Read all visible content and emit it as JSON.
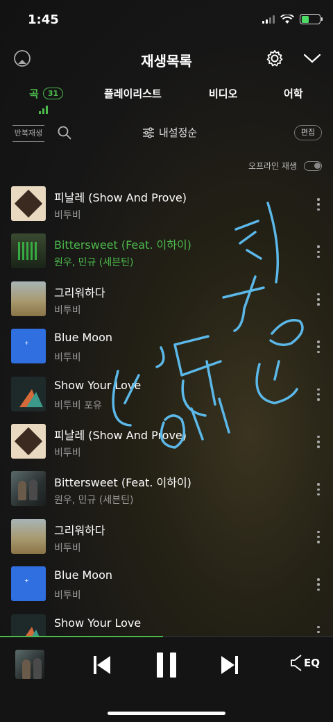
{
  "status_bar": {
    "time": "1:45",
    "battery_level": 0.4
  },
  "header": {
    "title": "재생목록"
  },
  "tabs": [
    {
      "label": "곡",
      "count": "31",
      "active": true
    },
    {
      "label": "플레이리스트"
    },
    {
      "label": "비디오"
    },
    {
      "label": "어학"
    }
  ],
  "toolbar": {
    "repeat_label": "반복재생",
    "sort_label": "내설정순",
    "edit_label": "편집"
  },
  "offline": {
    "label": "오프라인 재생",
    "enabled": false
  },
  "songs": [
    {
      "title": "피날레 (Show And Prove)",
      "artist": "비투비",
      "active": false
    },
    {
      "title": "Bittersweet (Feat. 이하이)",
      "artist": "원우, 민규 (세븐틴)",
      "active": true
    },
    {
      "title": "그리워하다",
      "artist": "비투비",
      "active": false
    },
    {
      "title": "Blue Moon",
      "artist": "비투비",
      "active": false
    },
    {
      "title": "Show Your Love",
      "artist": "비투비 포유",
      "active": false
    },
    {
      "title": "피날레 (Show And Prove)",
      "artist": "비투비",
      "active": false
    },
    {
      "title": "Bittersweet (Feat. 이하이)",
      "artist": "원우, 민규 (세븐틴)",
      "active": false
    },
    {
      "title": "그리워하다",
      "artist": "비투비",
      "active": false
    },
    {
      "title": "Blue Moon",
      "artist": "비투비",
      "active": false
    },
    {
      "title": "Show Your Love",
      "artist": "",
      "active": false
    }
  ],
  "player": {
    "progress": 0.49,
    "eq_label": "EQ"
  },
  "colors": {
    "accent": "#4cba4c",
    "handwriting": "#5bb8e8",
    "background": "#161616"
  },
  "icons": [
    "airplay-icon",
    "gear-icon",
    "chevron-down-icon",
    "search-icon",
    "sort-sliders-icon",
    "previous-icon",
    "pause-icon",
    "next-icon",
    "eq-speaker-icon"
  ]
}
